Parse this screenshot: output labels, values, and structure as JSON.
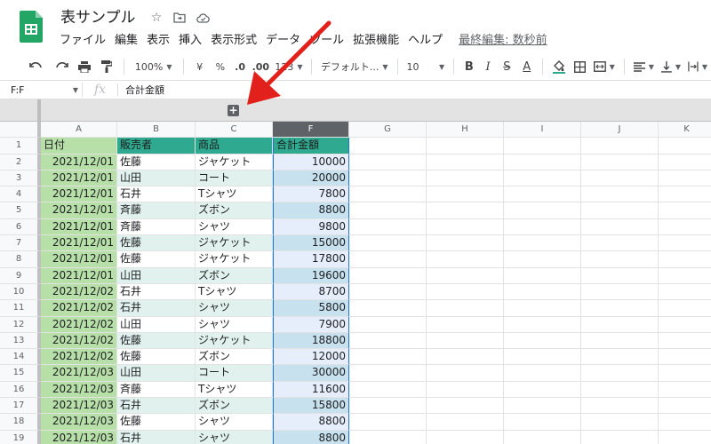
{
  "title": "表サンプル",
  "menu": [
    "ファイル",
    "編集",
    "表示",
    "挿入",
    "表示形式",
    "データ",
    "ツール",
    "拡張機能",
    "ヘルプ"
  ],
  "last_edit": "最終編集: 数秒前",
  "toolbar": {
    "zoom": "100%",
    "currency": "¥",
    "percent": "%",
    "dec_decrease": ".0",
    "dec_increase": ".00",
    "number_format": "123",
    "font": "デフォルト...",
    "font_size": "10",
    "bold": "B",
    "italic": "I",
    "strike": "S",
    "text_color": "A"
  },
  "formula_bar": {
    "name_box": "F:F",
    "fx": "fx",
    "content": "合計金額"
  },
  "columns": [
    "A",
    "B",
    "C",
    "F",
    "G",
    "H",
    "I",
    "J",
    "K"
  ],
  "selected_column": "F",
  "table": {
    "headers": [
      "日付",
      "販売者",
      "商品",
      "合計金額"
    ],
    "rows": [
      [
        "2021/12/01",
        "佐藤",
        "ジャケット",
        "10000"
      ],
      [
        "2021/12/01",
        "山田",
        "コート",
        "20000"
      ],
      [
        "2021/12/01",
        "石井",
        "Tシャツ",
        "7800"
      ],
      [
        "2021/12/01",
        "斉藤",
        "ズボン",
        "8800"
      ],
      [
        "2021/12/01",
        "斉藤",
        "シャツ",
        "9800"
      ],
      [
        "2021/12/01",
        "佐藤",
        "ジャケット",
        "15000"
      ],
      [
        "2021/12/01",
        "佐藤",
        "ジャケット",
        "17800"
      ],
      [
        "2021/12/01",
        "山田",
        "ズボン",
        "19600"
      ],
      [
        "2021/12/02",
        "石井",
        "Tシャツ",
        "8700"
      ],
      [
        "2021/12/02",
        "石井",
        "シャツ",
        "5800"
      ],
      [
        "2021/12/02",
        "山田",
        "シャツ",
        "7900"
      ],
      [
        "2021/12/02",
        "佐藤",
        "ジャケット",
        "18800"
      ],
      [
        "2021/12/02",
        "佐藤",
        "ズボン",
        "12000"
      ],
      [
        "2021/12/03",
        "山田",
        "コート",
        "30000"
      ],
      [
        "2021/12/03",
        "斉藤",
        "Tシャツ",
        "11600"
      ],
      [
        "2021/12/03",
        "石井",
        "ズボン",
        "15800"
      ],
      [
        "2021/12/03",
        "佐藤",
        "シャツ",
        "8800"
      ],
      [
        "2021/12/03",
        "石井",
        "シャツ",
        "8800"
      ]
    ]
  },
  "colors": {
    "logo": "#23a566",
    "selection": "#1a73e8",
    "header_green": "#2fa98f",
    "date_green": "#b7dfa8",
    "arrow": "#e3211c"
  }
}
